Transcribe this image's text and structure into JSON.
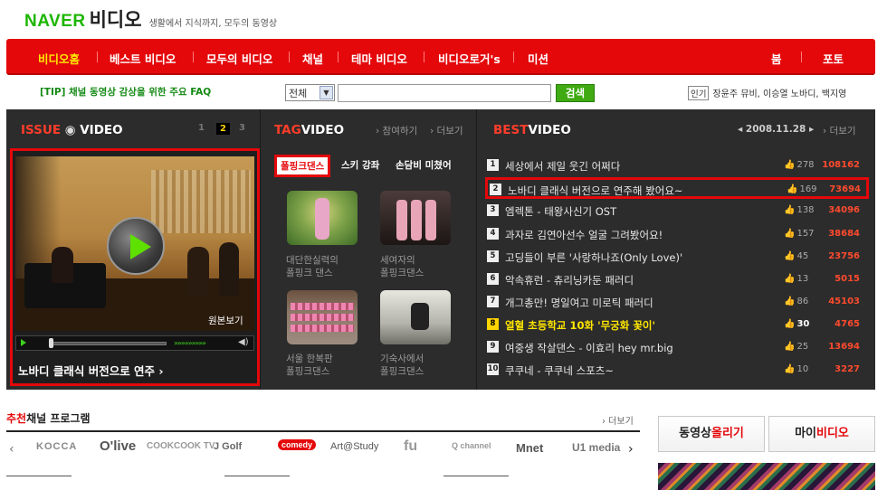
{
  "header": {
    "logo_naver": "NAVER",
    "logo_video": "비디오",
    "slogan": "생활에서 지식까지, 모두의 동영상"
  },
  "gnb": {
    "items": [
      "비디오홈",
      "베스트 비디오",
      "모두의 비디오",
      "채널",
      "테마 비디오",
      "비디오로거's",
      "미션"
    ],
    "right_items": [
      "붐",
      "포토"
    ]
  },
  "search": {
    "tip": "[TIP] 채널 동영상 감상을 위한 주요 FAQ",
    "select_value": "전체",
    "input_value": "",
    "button_label": "검색",
    "popular_tag": "인기",
    "popular_text": "장윤주 뮤비, 이승열 노바디, 백지영"
  },
  "issue": {
    "title_red": "ISSUE",
    "title_white": "VIDEO",
    "pages": [
      "1",
      "2",
      "3"
    ],
    "original_view": "원본보기",
    "caption": "노바디 클래식 버전으로 연주 ›",
    "progress": 0.0
  },
  "tag": {
    "title_red": "TAG",
    "title_white": "VIDEO",
    "link_participate": "› 참여하기",
    "link_more": "› 더보기",
    "tabs": [
      "폴핑크댄스",
      "스키 강좌",
      "손담비 미쳤어"
    ],
    "thumbs": [
      {
        "caption": "대단한실력의\n폴핑크 댄스"
      },
      {
        "caption": "세여자의\n폴핑크댄스"
      },
      {
        "caption": "서울 한복판\n폴핑크댄스"
      },
      {
        "caption": "기숙사에서\n폴핑크댄스"
      }
    ]
  },
  "best": {
    "title_red": "BEST",
    "title_white": "VIDEO",
    "date": "◂ 2008.11.28 ▸",
    "link_more": "› 더보기",
    "rows": [
      {
        "rank": "1",
        "title": "세상에서 제일 웃긴 어쩌다",
        "likes": "278",
        "views": "108162"
      },
      {
        "rank": "2",
        "title": "노바디 클래식 버전으로 연주해 봤어요~",
        "likes": "169",
        "views": "73694"
      },
      {
        "rank": "3",
        "title": "엠렉톤 - 태왕사신기 OST",
        "likes": "138",
        "views": "34096"
      },
      {
        "rank": "4",
        "title": "과자로 김연아선수 얼굴 그려봤어요!",
        "likes": "157",
        "views": "38684"
      },
      {
        "rank": "5",
        "title": "고딩들이 부른 '사랑하나죠(Only Love)'",
        "likes": "45",
        "views": "23756"
      },
      {
        "rank": "6",
        "title": "악속휴런 - 츄리닝카둔 패러디",
        "likes": "13",
        "views": "5015"
      },
      {
        "rank": "7",
        "title": "개그총만! 명일여고 미로틱 패러디",
        "likes": "86",
        "views": "45103"
      },
      {
        "rank": "8",
        "title": "열혈 초등학교 10화 '무궁화 꽃이'",
        "likes": "30",
        "views": "4765"
      },
      {
        "rank": "9",
        "title": "여중생 작살댄스 - 이효리 hey mr.big",
        "likes": "25",
        "views": "13694"
      },
      {
        "rank": "10",
        "title": "쿠쿠네 - 쿠쿠네 스포츠~",
        "likes": "10",
        "views": "3227"
      }
    ]
  },
  "recommend": {
    "title_red": "추천",
    "title_rest": "채널 프로그램",
    "more": "› 더보기",
    "logos": [
      "KOCCA",
      "O'live",
      "COOKCOOK TV",
      "J Golf",
      "comedy",
      "Art@Study",
      "fu",
      "Q channel",
      "Mnet",
      "U1 media"
    ]
  },
  "side": {
    "upload_pre": "동영상",
    "upload_red": "올리기",
    "my_pre": "마이",
    "my_red": "비디오"
  },
  "colors": {
    "naver_green": "#1db600",
    "gnb_red": "#e4080b",
    "active_yellow": "#ffe900",
    "dark_panel": "#2c2c2c"
  }
}
